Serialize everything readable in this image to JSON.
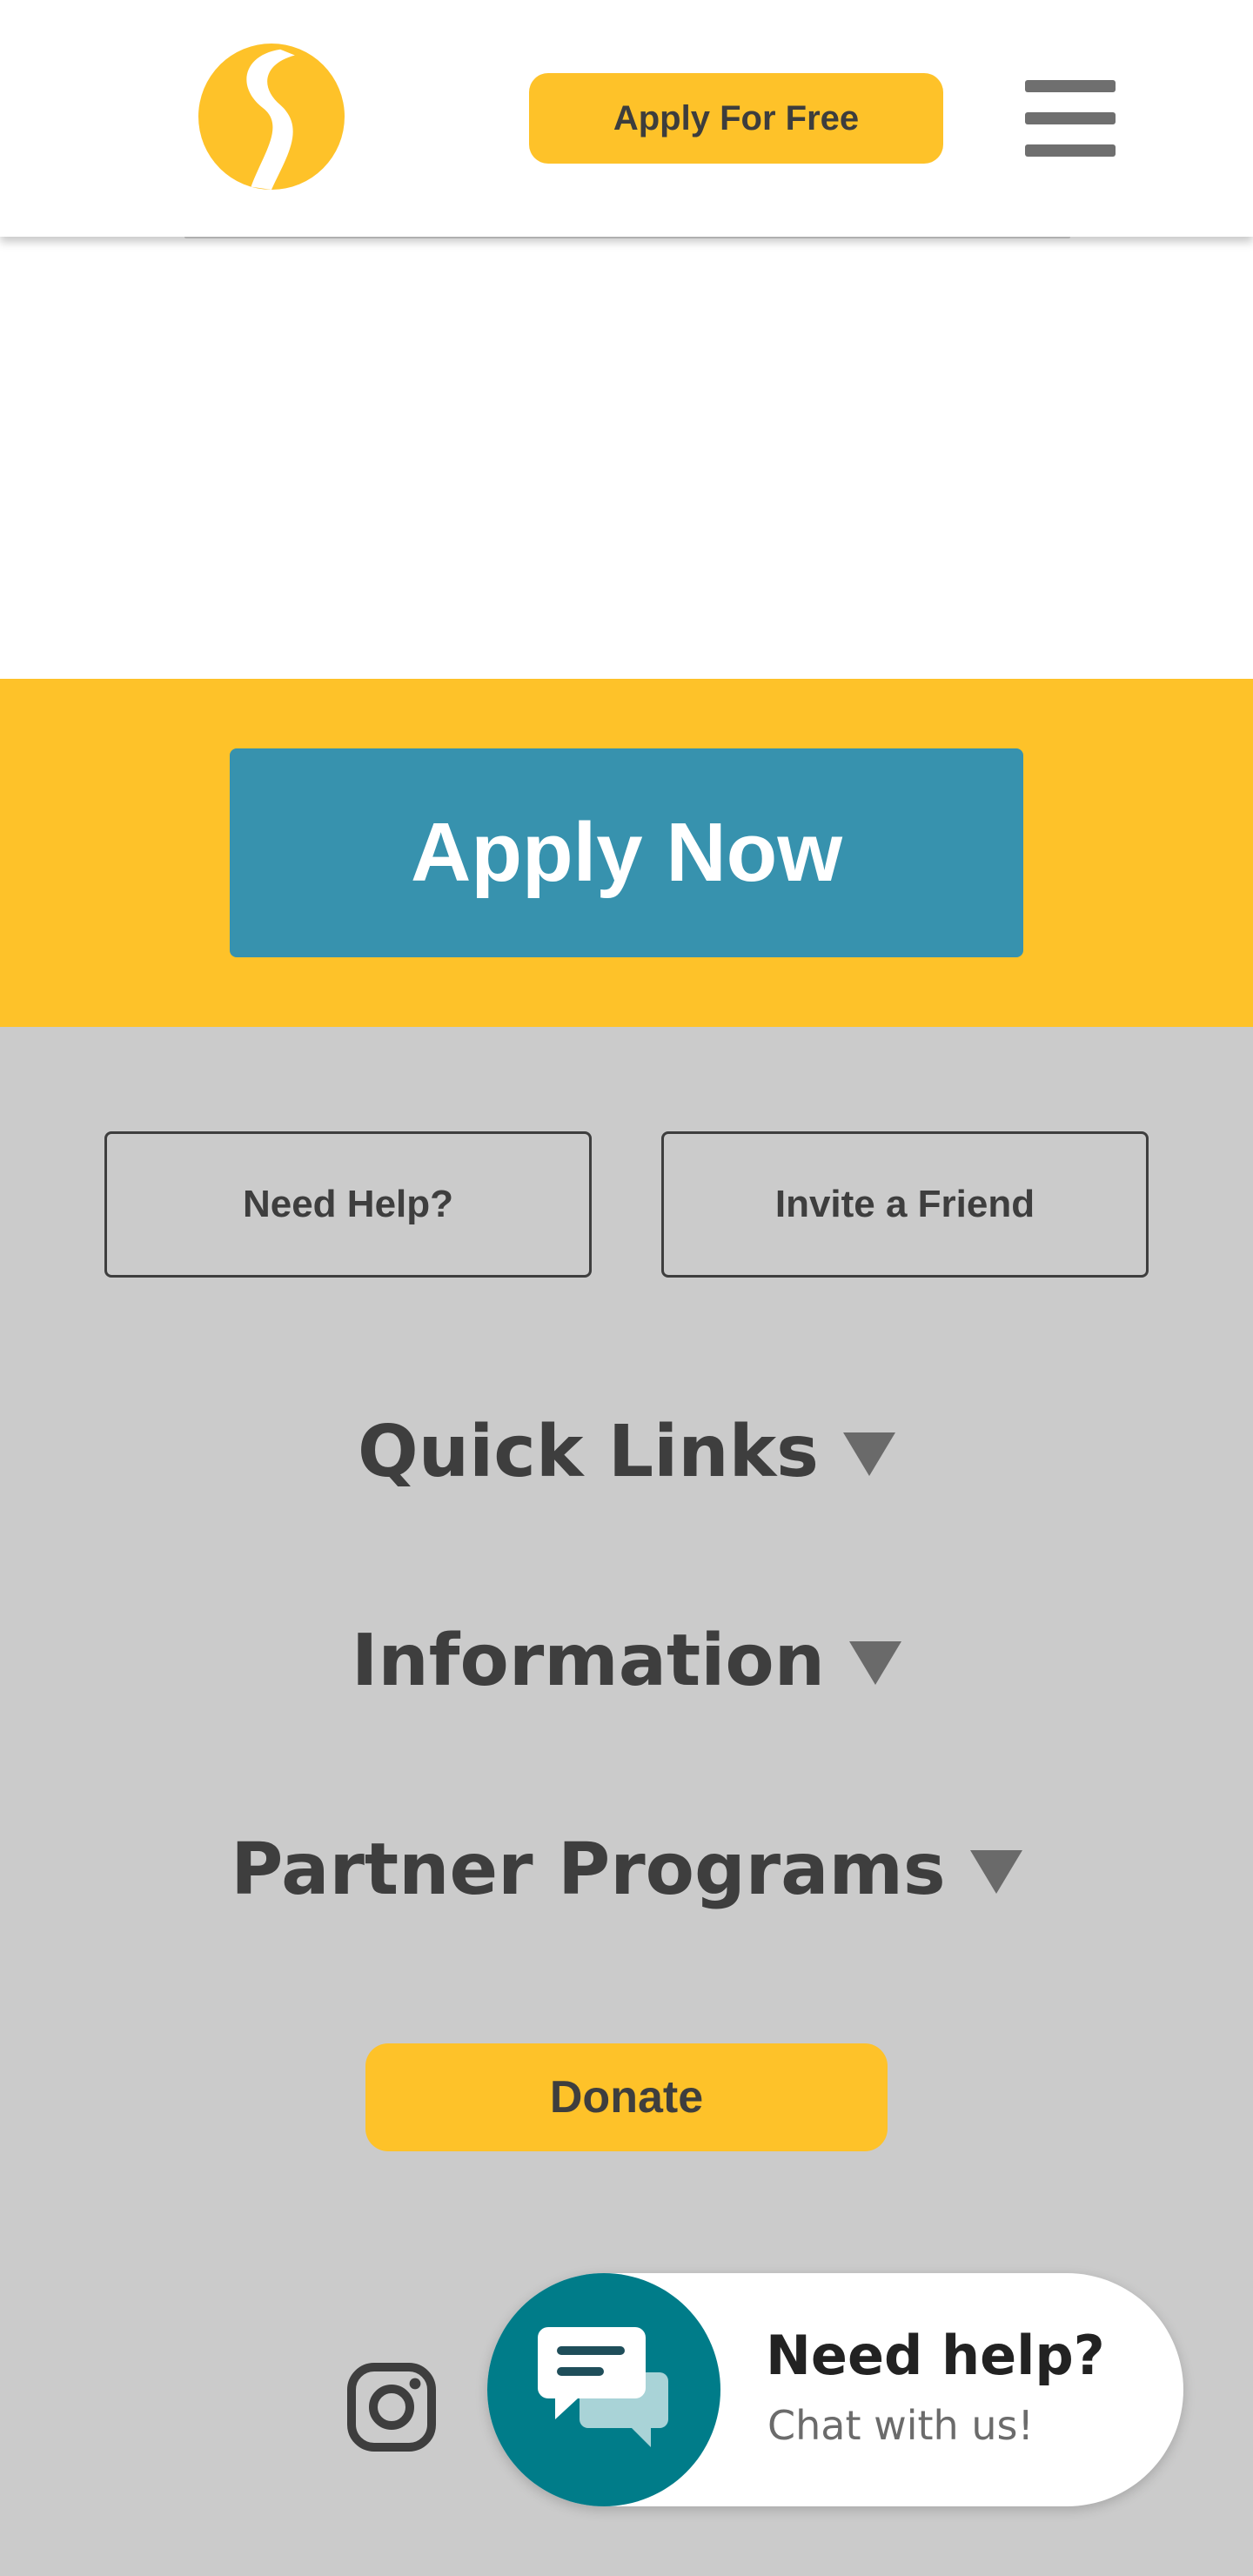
{
  "header": {
    "logo_icon": "road-logo-icon",
    "apply_label": "Apply For Free",
    "menu_icon": "hamburger-menu-icon"
  },
  "cta": {
    "apply_now_label": "Apply Now"
  },
  "footer": {
    "need_help_label": "Need Help?",
    "invite_label": "Invite a Friend",
    "sections": [
      {
        "label": "Quick Links"
      },
      {
        "label": "Information"
      },
      {
        "label": "Partner Programs"
      }
    ],
    "donate_label": "Donate",
    "social_icon": "instagram-icon"
  },
  "chat": {
    "title": "Need help?",
    "subtitle": "Chat with us!",
    "icon": "chat-bubbles-icon"
  },
  "colors": {
    "brand_yellow": "#fec229",
    "apply_blue": "#3792ae",
    "footer_gray": "#cbcbcb",
    "chat_teal": "#007c89",
    "text_dark": "#3e3e3e"
  }
}
